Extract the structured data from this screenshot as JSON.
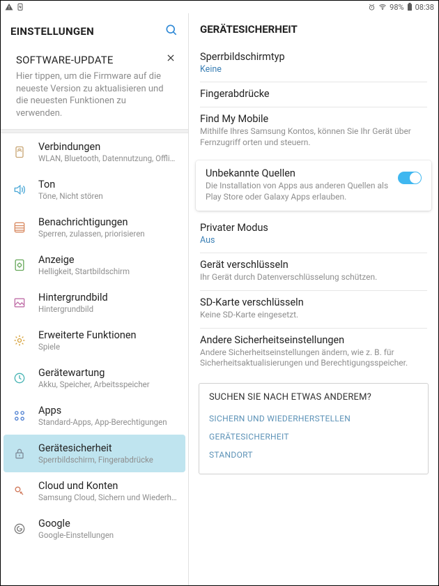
{
  "status": {
    "battery": "98%",
    "time": "08:38"
  },
  "left": {
    "title": "EINSTELLUNGEN",
    "banner": {
      "title": "SOFTWARE-UPDATE",
      "body": "Hier tippen, um die Firmware auf die neueste Version zu aktualisieren und die neuesten Funktionen zu verwenden."
    },
    "items": [
      {
        "label": "Verbindungen",
        "sub": "WLAN, Bluetooth, Datennutzung, Offline..."
      },
      {
        "label": "Ton",
        "sub": "Töne, Nicht stören"
      },
      {
        "label": "Benachrichtigungen",
        "sub": "Sperren, zulassen, priorisieren"
      },
      {
        "label": "Anzeige",
        "sub": "Helligkeit, Startbildschirm"
      },
      {
        "label": "Hintergrundbild",
        "sub": "Hintergrundbild"
      },
      {
        "label": "Erweiterte Funktionen",
        "sub": "Spiele"
      },
      {
        "label": "Gerätewartung",
        "sub": "Akku, Speicher, Arbeitsspeicher"
      },
      {
        "label": "Apps",
        "sub": "Standard-Apps, App-Berechtigungen"
      },
      {
        "label": "Gerätesicherheit",
        "sub": "Sperrbildschirm, Fingerabdrücke"
      },
      {
        "label": "Cloud und Konten",
        "sub": "Samsung Cloud, Sichern und Wiederher..."
      },
      {
        "label": "Google",
        "sub": "Google-Einstellungen"
      }
    ]
  },
  "right": {
    "title": "GERÄTESICHERHEIT",
    "rows": {
      "lock": {
        "title": "Sperrbildschirmtyp",
        "value": "Keine"
      },
      "finger": {
        "title": "Fingerabdrücke"
      },
      "findmy": {
        "title": "Find My Mobile",
        "sub": "Mithilfe Ihres Samsung Kontos, können Sie Ihr Gerät über Fernzugriff orten und steuern."
      },
      "unknown": {
        "title": "Unbekannte Quellen",
        "sub": "Die Installation von Apps aus anderen Quellen als Play Store oder Galaxy Apps erlauben."
      },
      "private": {
        "title": "Privater Modus",
        "value": "Aus"
      },
      "encrypt": {
        "title": "Gerät verschlüsseln",
        "sub": "Ihr Gerät durch Datenverschlüsselung schützen."
      },
      "sd": {
        "title": "SD-Karte verschlüsseln",
        "sub": "Keine SD-Karte eingesetzt."
      },
      "other": {
        "title": "Andere Sicherheitseinstellungen",
        "sub": "Andere Sicherheitseinstellungen ändern, wie z. B. für Sicherheitsaktualisierungen und Berechtigungsspeicher."
      }
    },
    "search": {
      "title": "SUCHEN SIE NACH ETWAS ANDEREM?",
      "links": [
        "SICHERN UND WIEDERHERSTELLEN",
        "GERÄTESICHERHEIT",
        "STANDORT"
      ]
    }
  }
}
